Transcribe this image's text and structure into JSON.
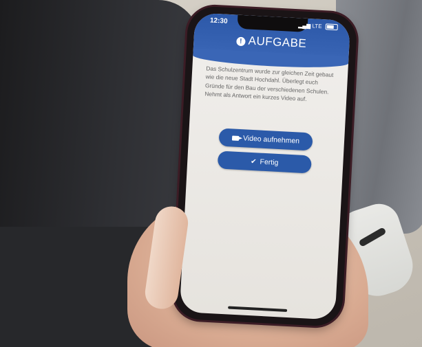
{
  "status_bar": {
    "time": "12:30",
    "network": "LTE"
  },
  "header": {
    "icon": "info-icon",
    "title": "AUFGABE"
  },
  "task": {
    "text": "Das Schulzentrum wurde zur gleichen Zeit gebaut wie die neue Stadt Hochdahl. Überlegt euch Gründe für den Bau der verschiedenen Schulen. Nehmt als Antwort ein kurzes Video auf."
  },
  "buttons": {
    "record_video": {
      "icon": "video-camera-icon",
      "label": "Video aufnehmen"
    },
    "done": {
      "icon": "checkmark-icon",
      "label": "Fertig"
    }
  },
  "colors": {
    "accent": "#2b5aa9",
    "screen_background": "#f1efec"
  }
}
